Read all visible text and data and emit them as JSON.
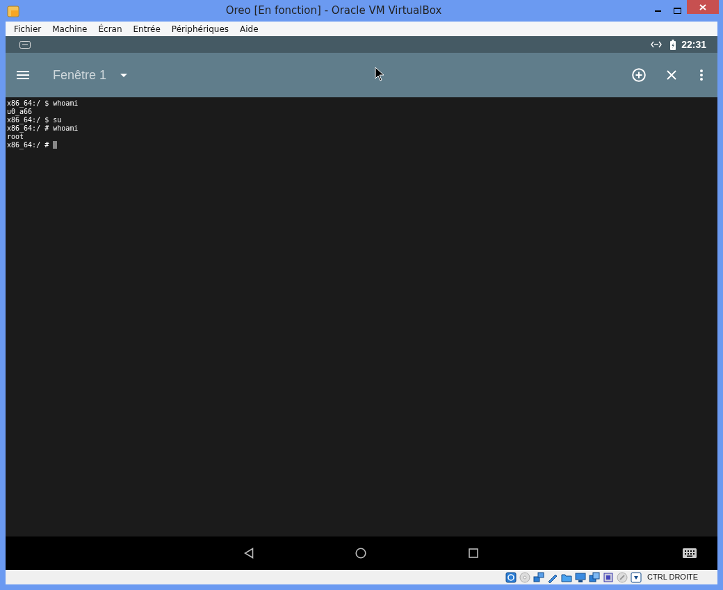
{
  "window": {
    "title": "Oreo [En fonction] - Oracle VM VirtualBox"
  },
  "menu": [
    "Fichier",
    "Machine",
    "Écran",
    "Entrée",
    "Périphériques",
    "Aide"
  ],
  "android_status": {
    "time": "22:31"
  },
  "toolbar": {
    "title": "Fenêtre 1"
  },
  "terminal": {
    "lines": [
      "x86_64:/ $ whoami",
      "u0_a66",
      "x86_64:/ $ su",
      "x86_64:/ # whoami",
      "root",
      "x86_64:/ # "
    ],
    "cursor": true
  },
  "status_bar": {
    "host_key": "CTRL DROITE"
  }
}
